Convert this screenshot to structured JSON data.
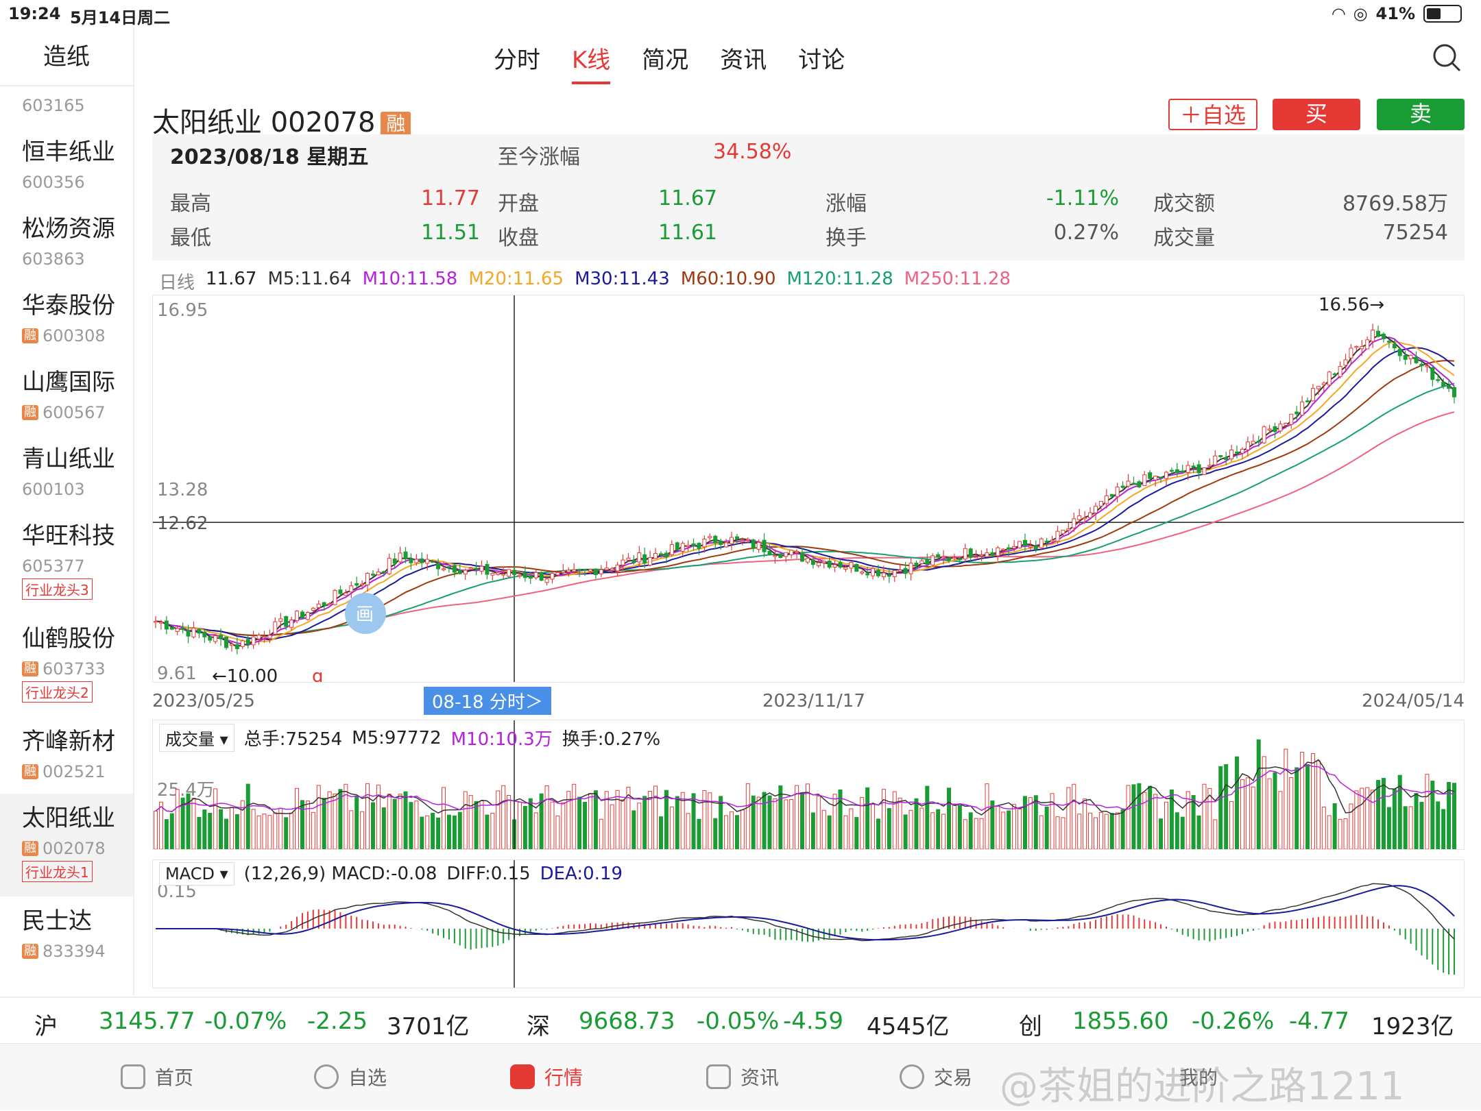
{
  "status": {
    "time": "19:24",
    "date": "5月14日周二",
    "battery": "41%"
  },
  "sidebar": {
    "title": "造纸",
    "partial_code": "603165",
    "items": [
      {
        "name": "恒丰纸业",
        "code": "600356",
        "rong": false,
        "tag": ""
      },
      {
        "name": "松炀资源",
        "code": "603863",
        "rong": false,
        "tag": ""
      },
      {
        "name": "华泰股份",
        "code": "600308",
        "rong": true,
        "tag": ""
      },
      {
        "name": "山鹰国际",
        "code": "600567",
        "rong": true,
        "tag": ""
      },
      {
        "name": "青山纸业",
        "code": "600103",
        "rong": false,
        "tag": ""
      },
      {
        "name": "华旺科技",
        "code": "605377",
        "rong": false,
        "tag": "行业龙头3"
      },
      {
        "name": "仙鹤股份",
        "code": "603733",
        "rong": true,
        "tag": "行业龙头2"
      },
      {
        "name": "齐峰新材",
        "code": "002521",
        "rong": true,
        "tag": ""
      },
      {
        "name": "太阳纸业",
        "code": "002078",
        "rong": true,
        "tag": "行业龙头1",
        "active": true
      },
      {
        "name": "民士达",
        "code": "833394",
        "rong": true,
        "tag": ""
      }
    ],
    "rong_label": "融"
  },
  "tabs": [
    "分时",
    "K线",
    "简况",
    "资讯",
    "讨论"
  ],
  "active_tab": "K线",
  "stock": {
    "name": "太阳纸业 002078",
    "rong": "融"
  },
  "buttons": {
    "add": "＋自选",
    "buy": "买",
    "sell": "卖"
  },
  "info": {
    "date": "2023/08/18  星期五",
    "since_label": "至今涨幅",
    "since_value": "34.58%",
    "high_label": "最高",
    "high": "11.77",
    "low_label": "最低",
    "low": "11.51",
    "open_label": "开盘",
    "open": "11.67",
    "close_label": "收盘",
    "close": "11.61",
    "chg_label": "涨幅",
    "chg": "-1.11%",
    "turn_label": "换手",
    "turn": "0.27%",
    "amt_label": "成交额",
    "amt": "8769.58万",
    "vol_label": "成交量",
    "vol": "75254"
  },
  "ma": {
    "day": "日线",
    "price": "11.67",
    "m5": "M5:11.64",
    "m10": "M10:11.58",
    "m20": "M20:11.65",
    "m30": "M30:11.43",
    "m60": "M60:10.90",
    "m120": "M120:11.28",
    "m250": "M250:11.28"
  },
  "colors": {
    "up": "#e53935",
    "down": "#1a9c34",
    "m5": "#333333",
    "m10": "#b620e0",
    "m20": "#f5a623",
    "m30": "#1a1a9c",
    "m60": "#a0390d",
    "m120": "#16a070",
    "m250": "#f06080"
  },
  "chart_data": {
    "type": "candlestick",
    "y_top_label": "16.95",
    "y_mid_label": "13.28",
    "crosshair_label": "12.62",
    "y_low_label": "9.61",
    "low_marker": "←10.00",
    "high_marker": "16.56→",
    "ylim": [
      9.61,
      16.95
    ],
    "x_start": "2023/05/25",
    "x_mid": "2023/11/17",
    "x_end": "2024/05/14",
    "crosshair_date": "08-18 分时＞",
    "key_points": [
      {
        "x": "2023/05/25",
        "close": 10.6
      },
      {
        "x": "2023/06/15",
        "close": 10.1
      },
      {
        "x": "2023/07/05",
        "close": 10.9
      },
      {
        "x": "2023/07/20",
        "close": 11.9
      },
      {
        "x": "2023/08/18",
        "close": 11.61
      },
      {
        "x": "2023/09/10",
        "close": 11.5
      },
      {
        "x": "2023/10/01",
        "close": 11.9
      },
      {
        "x": "2023/10/20",
        "close": 12.3
      },
      {
        "x": "2023/11/17",
        "close": 11.9
      },
      {
        "x": "2023/12/20",
        "close": 11.6
      },
      {
        "x": "2024/01/20",
        "close": 12.0
      },
      {
        "x": "2024/02/05",
        "close": 12.2
      },
      {
        "x": "2024/02/25",
        "close": 13.4
      },
      {
        "x": "2024/03/20",
        "close": 13.8
      },
      {
        "x": "2024/04/10",
        "close": 14.8
      },
      {
        "x": "2024/04/25",
        "close": 16.56
      },
      {
        "x": "2024/05/14",
        "close": 15.3
      }
    ]
  },
  "volume": {
    "label": "成交量",
    "total": "总手:75254",
    "m5": "M5:97772",
    "m10": "M10:10.3万",
    "turn": "换手:0.27%",
    "ytick": "25.4万"
  },
  "macd": {
    "label": "MACD",
    "params": "(12,26,9) MACD:-0.08",
    "diff": "DIFF:0.15",
    "dea": "DEA:0.19",
    "ytick": "0.15"
  },
  "ticker": {
    "sh": {
      "name": "沪",
      "price": "3145.77",
      "pct": "-0.07%",
      "chg": "-2.25",
      "amt": "3701亿"
    },
    "sz": {
      "name": "深",
      "price": "9668.73",
      "pct": "-0.05%",
      "chg": "-4.59",
      "amt": "4545亿"
    },
    "cy": {
      "name": "创",
      "price": "1855.60",
      "pct": "-0.26%",
      "chg": "-4.77",
      "amt": "1923亿"
    }
  },
  "nav": [
    "首页",
    "自选",
    "行情",
    "资讯",
    "交易",
    "我的"
  ],
  "watermark": "@茶姐的进阶之路1211",
  "float_btn": "画",
  "q_mark": "q"
}
